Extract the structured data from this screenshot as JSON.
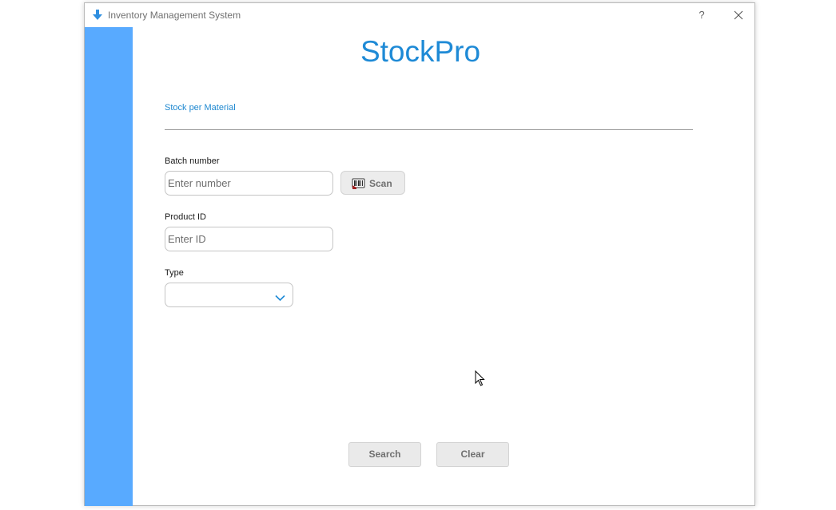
{
  "window": {
    "title": "Inventory Management System",
    "help_label": "?"
  },
  "brand": {
    "name": "StockPro"
  },
  "form": {
    "section_title": "Stock per Material",
    "batch": {
      "label": "Batch number",
      "placeholder": "Enter number",
      "value": ""
    },
    "scan_button": {
      "label": "Scan"
    },
    "product": {
      "label": "Product ID",
      "placeholder": "Enter ID",
      "value": ""
    },
    "type": {
      "label": "Type",
      "selected": ""
    }
  },
  "actions": {
    "search_label": "Search",
    "clear_label": "Clear"
  },
  "colors": {
    "sidebar": "#58aaff",
    "brand": "#1e8ad6",
    "section_title": "#1e88d0",
    "app_icon": "#2f8fe0"
  },
  "icons": {
    "app": "download-arrow-icon",
    "help": "question-icon",
    "close": "close-icon",
    "scan": "scanner-icon",
    "dropdown": "chevron-down-icon",
    "cursor": "mouse-pointer-icon"
  }
}
